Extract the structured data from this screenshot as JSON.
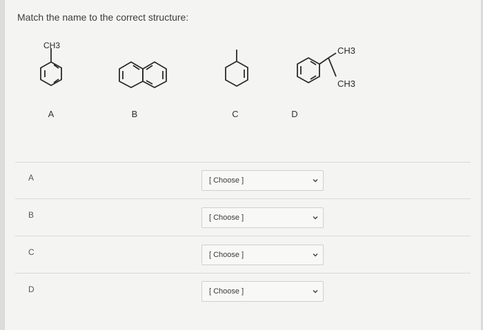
{
  "prompt": "Match the name to the correct structure:",
  "structures": [
    {
      "label": "A",
      "name": "toluene-structure",
      "substituent": "CH3"
    },
    {
      "label": "B",
      "name": "naphthalene-structure"
    },
    {
      "label": "C",
      "name": "methylcyclohexene-structure"
    },
    {
      "label": "D",
      "name": "dimethylbenzene-structure",
      "substituents": [
        "CH3",
        "CH3"
      ]
    }
  ],
  "rows": [
    {
      "letter": "A",
      "selected": "[ Choose ]"
    },
    {
      "letter": "B",
      "selected": "[ Choose ]"
    },
    {
      "letter": "C",
      "selected": "[ Choose ]"
    },
    {
      "letter": "D",
      "selected": "[ Choose ]"
    }
  ]
}
